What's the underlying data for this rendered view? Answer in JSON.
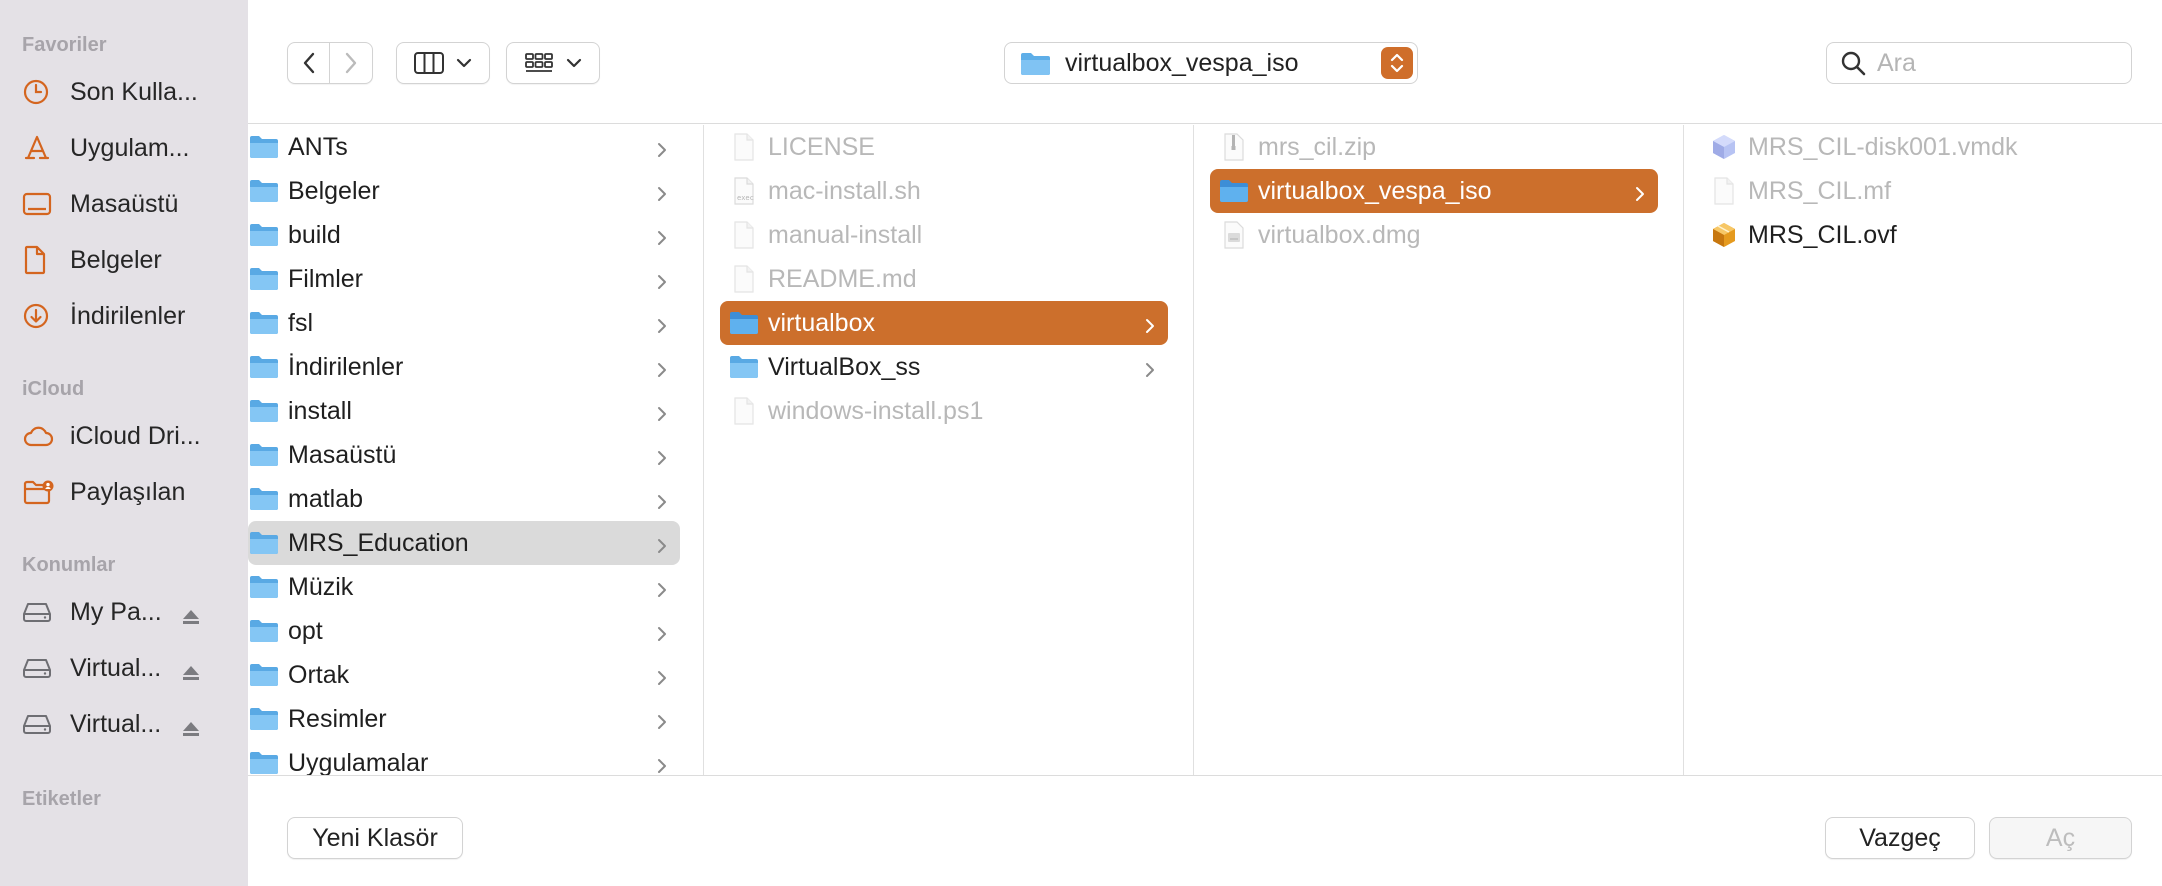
{
  "sidebar": {
    "favorites_title": "Favoriler",
    "favorites": [
      {
        "label": "Son Kulla...",
        "icon": "clock-icon"
      },
      {
        "label": "Uygulam...",
        "icon": "applications-icon"
      },
      {
        "label": "Masaüstü",
        "icon": "desktop-icon"
      },
      {
        "label": "Belgeler",
        "icon": "document-icon"
      },
      {
        "label": "İndirilenler",
        "icon": "download-icon"
      }
    ],
    "icloud_title": "iCloud",
    "icloud": [
      {
        "label": "iCloud Dri...",
        "icon": "cloud-icon"
      },
      {
        "label": "Paylaşılan",
        "icon": "shared-folder-icon"
      }
    ],
    "locations_title": "Konumlar",
    "locations": [
      {
        "label": "My Pa...",
        "icon": "drive-icon"
      },
      {
        "label": "Virtual...",
        "icon": "drive-icon"
      },
      {
        "label": "Virtual...",
        "icon": "drive-icon"
      }
    ],
    "tags_title": "Etiketler"
  },
  "toolbar": {
    "path_label": "virtualbox_vespa_iso",
    "search_placeholder": "Ara"
  },
  "columns": [
    {
      "items": [
        {
          "name": "ANTs",
          "type": "folder",
          "arrow": true
        },
        {
          "name": "Belgeler",
          "type": "folder",
          "arrow": true
        },
        {
          "name": "build",
          "type": "folder",
          "arrow": true
        },
        {
          "name": "Filmler",
          "type": "folder",
          "arrow": true
        },
        {
          "name": "fsl",
          "type": "folder",
          "arrow": true
        },
        {
          "name": "İndirilenler",
          "type": "folder",
          "arrow": true
        },
        {
          "name": "install",
          "type": "folder",
          "arrow": true
        },
        {
          "name": "Masaüstü",
          "type": "folder",
          "arrow": true
        },
        {
          "name": "matlab",
          "type": "folder",
          "arrow": true
        },
        {
          "name": "MRS_Education",
          "type": "folder",
          "arrow": true,
          "state": "highlighted"
        },
        {
          "name": "Müzik",
          "type": "folder",
          "arrow": true
        },
        {
          "name": "opt",
          "type": "folder",
          "arrow": true
        },
        {
          "name": "Ortak",
          "type": "folder",
          "arrow": true
        },
        {
          "name": "Resimler",
          "type": "folder",
          "arrow": true
        },
        {
          "name": "Uygulamalar",
          "type": "folder",
          "arrow": true
        }
      ]
    },
    {
      "items": [
        {
          "name": "LICENSE",
          "type": "file",
          "dim": true
        },
        {
          "name": "mac-install.sh",
          "type": "script",
          "dim": true
        },
        {
          "name": "manual-install",
          "type": "file",
          "dim": true
        },
        {
          "name": "README.md",
          "type": "file",
          "dim": true
        },
        {
          "name": "virtualbox",
          "type": "folder",
          "arrow": true,
          "state": "selected"
        },
        {
          "name": "VirtualBox_ss",
          "type": "folder",
          "arrow": true
        },
        {
          "name": "windows-install.ps1",
          "type": "file",
          "dim": true
        }
      ]
    },
    {
      "items": [
        {
          "name": "mrs_cil.zip",
          "type": "zip",
          "dim": true
        },
        {
          "name": "virtualbox_vespa_iso",
          "type": "folder",
          "arrow": true,
          "state": "selected"
        },
        {
          "name": "virtualbox.dmg",
          "type": "dmg",
          "dim": true
        }
      ]
    },
    {
      "items": [
        {
          "name": "MRS_CIL-disk001.vmdk",
          "type": "vmdk",
          "dim": true
        },
        {
          "name": "MRS_CIL.mf",
          "type": "file",
          "dim": true
        },
        {
          "name": "MRS_CIL.ovf",
          "type": "ovf"
        }
      ]
    }
  ],
  "bottom": {
    "new_folder_label": "Yeni Klasör",
    "cancel_label": "Vazgeç",
    "open_label": "Aç"
  },
  "colors": {
    "accent": "#cc6f2c",
    "sidebar_bg": "#e4e1e6",
    "sidebar_icon": "#d4651f",
    "folder_blue": "#6cb8ef"
  }
}
